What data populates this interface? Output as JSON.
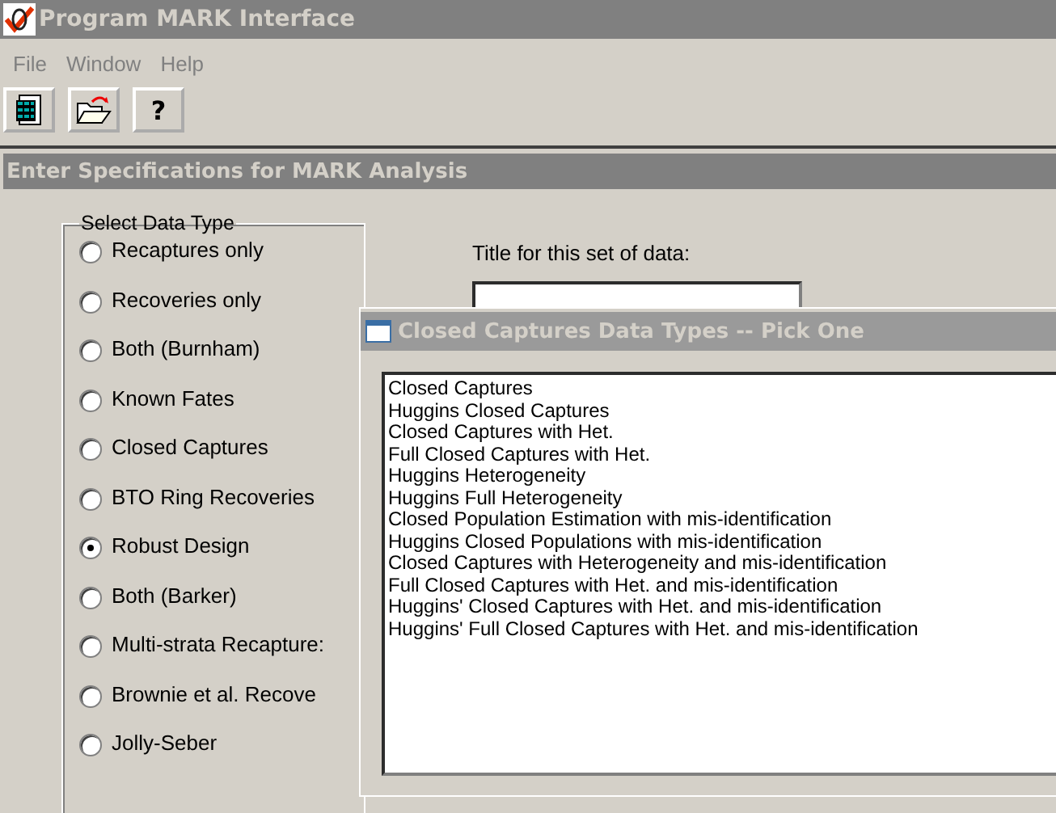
{
  "window": {
    "title": "Program MARK Interface"
  },
  "menu": [
    "File",
    "Window",
    "Help"
  ],
  "toolbar": [
    {
      "kind": "calculator"
    },
    {
      "kind": "open"
    },
    {
      "kind": "help",
      "label": "?"
    }
  ],
  "form": {
    "title": "Enter Specifications for MARK Analysis",
    "group": {
      "label": "Select Data Type",
      "options": [
        {
          "label": "Recaptures only",
          "selected": false
        },
        {
          "label": "Recoveries only",
          "selected": false
        },
        {
          "label": "Both (Burnham)",
          "selected": false
        },
        {
          "label": "Known Fates",
          "selected": false
        },
        {
          "label": "Closed Captures",
          "selected": false
        },
        {
          "label": "BTO Ring Recoveries",
          "selected": false
        },
        {
          "label": "Robust Design",
          "selected": true
        },
        {
          "label": "Both (Barker)",
          "selected": false
        },
        {
          "label": "Multi-strata Recapture:",
          "selected": false
        },
        {
          "label": "Brownie et al. Recove",
          "selected": false
        },
        {
          "label": "Jolly-Seber",
          "selected": false
        }
      ]
    },
    "title_label": "Title for this set of data:"
  },
  "dialog": {
    "title": "Closed Captures Data Types -- Pick One",
    "items": [
      "Closed Captures",
      "Huggins Closed Captures",
      "Closed Captures with Het.",
      "Full Closed Captures with Het.",
      "Huggins Heterogeneity",
      "Huggins Full Heterogeneity",
      "Closed Population Estimation with mis-identification",
      "Huggins Closed Populations with mis-identification",
      "Closed Captures with Heterogeneity and mis-identification",
      "Full Closed Captures with Het. and mis-identification",
      "Huggins' Closed Captures with Het. and mis-identification",
      "Huggins' Full Closed Captures with Het. and mis-identification"
    ]
  }
}
